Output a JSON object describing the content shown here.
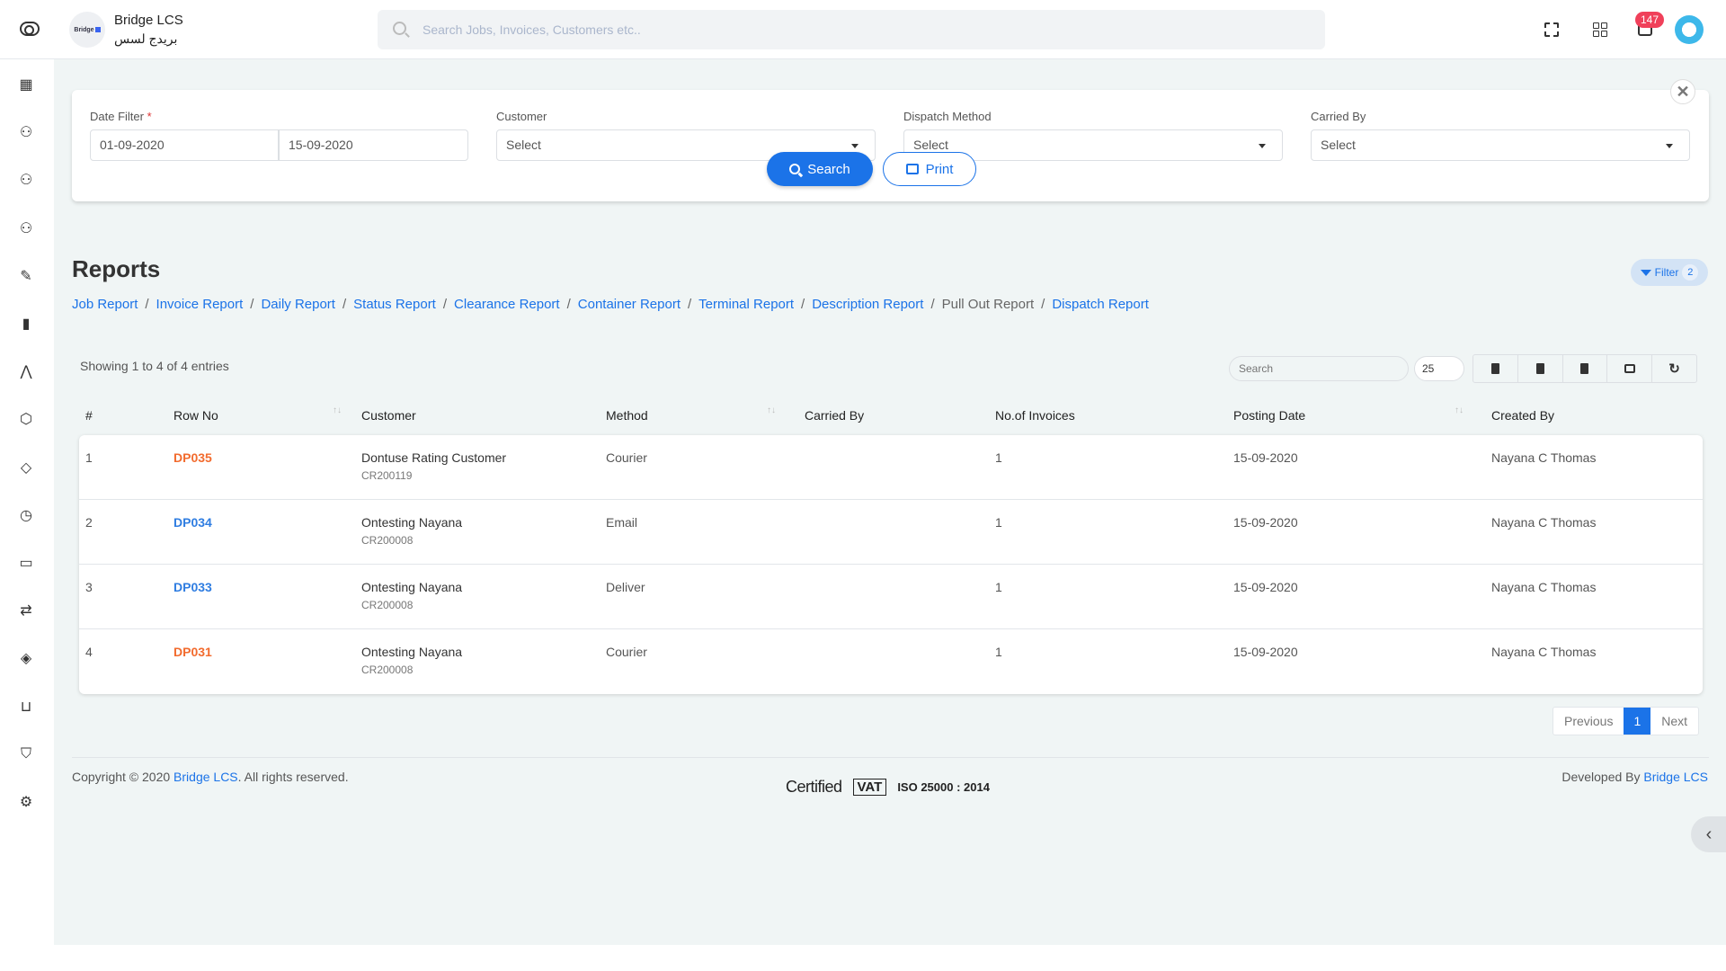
{
  "header": {
    "brand_name": "Bridge LCS",
    "brand_sub": "بريدج لسس",
    "logo_text": "Bridge",
    "search_placeholder": "Search Jobs, Invoices, Customers etc..",
    "notification_count": "147"
  },
  "sidebar": {
    "items": [
      {
        "name": "dashboard",
        "glyph": "▦"
      },
      {
        "name": "user",
        "glyph": "⚇"
      },
      {
        "name": "users",
        "glyph": "⚇"
      },
      {
        "name": "add-user",
        "glyph": "⚇"
      },
      {
        "name": "edit",
        "glyph": "✎"
      },
      {
        "name": "chart",
        "glyph": "▮"
      },
      {
        "name": "navigation",
        "glyph": "⋀"
      },
      {
        "name": "package",
        "glyph": "⬡"
      },
      {
        "name": "tag",
        "glyph": "◇"
      },
      {
        "name": "clock",
        "glyph": "◷"
      },
      {
        "name": "card",
        "glyph": "▭"
      },
      {
        "name": "repeat",
        "glyph": "⇄"
      },
      {
        "name": "codepen",
        "glyph": "◈"
      },
      {
        "name": "cart",
        "glyph": "⊔"
      },
      {
        "name": "shield",
        "glyph": "⛉"
      },
      {
        "name": "settings",
        "glyph": "⚙"
      }
    ]
  },
  "filters": {
    "date_label": "Date Filter",
    "required_mark": "*",
    "date_from": "01-09-2020",
    "date_to": "15-09-2020",
    "customer_label": "Customer",
    "customer_value": "Select",
    "dispatch_label": "Dispatch Method",
    "dispatch_value": "Select",
    "carried_label": "Carried By",
    "carried_value": "Select",
    "close_glyph": "✕",
    "search_button": "Search",
    "print_button": "Print"
  },
  "page": {
    "title": "Reports",
    "filter_pill": "Filter",
    "filter_count": "2",
    "breadcrumb": [
      {
        "label": "Job Report",
        "link": true
      },
      {
        "label": "Invoice Report",
        "link": true
      },
      {
        "label": "Daily Report",
        "link": true
      },
      {
        "label": "Status Report",
        "link": true
      },
      {
        "label": "Clearance Report",
        "link": true
      },
      {
        "label": "Container Report",
        "link": true
      },
      {
        "label": "Terminal Report",
        "link": true
      },
      {
        "label": "Description Report",
        "link": true
      },
      {
        "label": "Pull Out Report",
        "link": false
      },
      {
        "label": "Dispatch Report",
        "link": true
      }
    ]
  },
  "table": {
    "showing": "Showing 1 to 4 of 4 entries",
    "search_placeholder": "Search",
    "page_length": "25",
    "columns": [
      "#",
      "Row No",
      "Customer",
      "Method",
      "Carried By",
      "No.of Invoices",
      "Posting Date",
      "Created By"
    ],
    "sort_glyph": "↑↓",
    "rows": [
      {
        "idx": "1",
        "row_no": "DP035",
        "row_color": "#f26b2e",
        "customer": "Dontuse Rating Customer",
        "customer_code": "CR200119",
        "method": "Courier",
        "carried_by": "",
        "invoices": "1",
        "posting_date": "15-09-2020",
        "created_by": "Nayana C Thomas"
      },
      {
        "idx": "2",
        "row_no": "DP034",
        "row_color": "#2f7de1",
        "customer": "Ontesting Nayana",
        "customer_code": "CR200008",
        "method": "Email",
        "carried_by": "",
        "invoices": "1",
        "posting_date": "15-09-2020",
        "created_by": "Nayana C Thomas"
      },
      {
        "idx": "3",
        "row_no": "DP033",
        "row_color": "#2f7de1",
        "customer": "Ontesting Nayana",
        "customer_code": "CR200008",
        "method": "Deliver",
        "carried_by": "",
        "invoices": "1",
        "posting_date": "15-09-2020",
        "created_by": "Nayana C Thomas"
      },
      {
        "idx": "4",
        "row_no": "DP031",
        "row_color": "#f26b2e",
        "customer": "Ontesting Nayana",
        "customer_code": "CR200008",
        "method": "Courier",
        "carried_by": "",
        "invoices": "1",
        "posting_date": "15-09-2020",
        "created_by": "Nayana C Thomas"
      }
    ],
    "pagination": {
      "previous": "Previous",
      "current": "1",
      "next": "Next"
    }
  },
  "footer": {
    "copyright_prefix": "Copyright © 2020 ",
    "company": "Bridge LCS",
    "copyright_suffix": ". All rights reserved.",
    "cert_certified": "Certified",
    "cert_vat": "VAT",
    "cert_iso": "ISO 25000 : 2014",
    "developed_by": "Developed By ",
    "developer": "Bridge LCS"
  },
  "colors": {
    "accent": "#1b73e8",
    "orange": "#f26b2e",
    "badge": "#f0405a"
  }
}
